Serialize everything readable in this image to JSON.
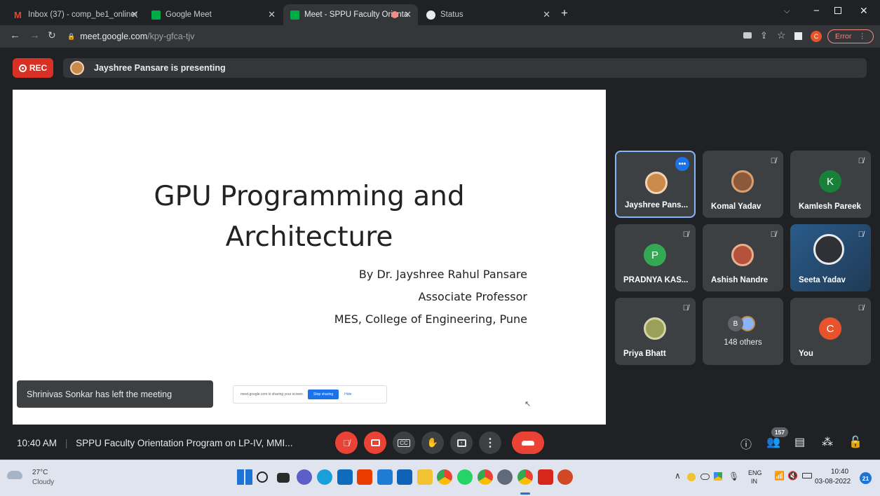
{
  "browser": {
    "tabs": [
      {
        "label": "Inbox (37) - comp_be1_online@",
        "favicon_color": "#ea4335",
        "active": false
      },
      {
        "label": "Google Meet",
        "favicon_color": "#00ac47",
        "active": false
      },
      {
        "label": "Meet - SPPU Faculty Orienta",
        "favicon_color": "#00ac47",
        "active": true
      },
      {
        "label": "Status",
        "favicon_color": "#e8eaed",
        "active": false
      }
    ],
    "url_domain": "meet.google.com",
    "url_path": "/kpy-gfca-tjv",
    "profile_initial": "C",
    "error_label": "Error"
  },
  "meet": {
    "rec_label": "REC",
    "presenter_banner": "Jayshree Pansare is presenting",
    "slide": {
      "title_line1": "GPU Programming and",
      "title_line2": "Architecture",
      "author": "By Dr. Jayshree Rahul Pansare",
      "position": "Associate Professor",
      "institution": "MES, College of Engineering, Pune"
    },
    "toast": "Shrinivas Sonkar has left the meeting",
    "share_bar": {
      "text": "meet.google.com is sharing your screen.",
      "stop_label": "Stop sharing",
      "hide_label": "Hide"
    },
    "participants": [
      {
        "name": "Jayshree Pans...",
        "type": "photo",
        "color": "#c98a4a",
        "muted": false,
        "active": true
      },
      {
        "name": "Komal Yadav",
        "type": "photo",
        "color": "#8a5a3a",
        "muted": true,
        "active": false
      },
      {
        "name": "Kamlesh Pareek",
        "type": "letter",
        "initial": "K",
        "color": "#188038",
        "muted": true,
        "active": false
      },
      {
        "name": "PRADNYA KAS...",
        "type": "letter",
        "initial": "P",
        "color": "#34a853",
        "muted": true,
        "active": false
      },
      {
        "name": "Ashish Nandre",
        "type": "photo",
        "color": "#b5523b",
        "muted": true,
        "active": false
      },
      {
        "name": "Seeta Yadav",
        "type": "logo",
        "color": "#2a5b8a",
        "muted": true,
        "active": false
      },
      {
        "name": "Priya Bhatt",
        "type": "photo",
        "color": "#9aa05a",
        "muted": true,
        "active": false
      },
      {
        "name": "148 others",
        "type": "others",
        "initial": "B",
        "color": "#5f6368",
        "muted": false,
        "active": false
      },
      {
        "name": "You",
        "type": "letter",
        "initial": "C",
        "color": "#e8532c",
        "muted": true,
        "active": false
      }
    ],
    "bottom": {
      "time": "10:40 AM",
      "meeting_title": "SPPU Faculty Orientation Program on LP-IV, MMI...",
      "participant_count": "157"
    }
  },
  "taskbar": {
    "weather_temp": "27°C",
    "weather_desc": "Cloudy",
    "lang_top": "ENG",
    "lang_bottom": "IN",
    "clock_time": "10:40",
    "clock_date": "03-08-2022",
    "notification_count": "21"
  }
}
